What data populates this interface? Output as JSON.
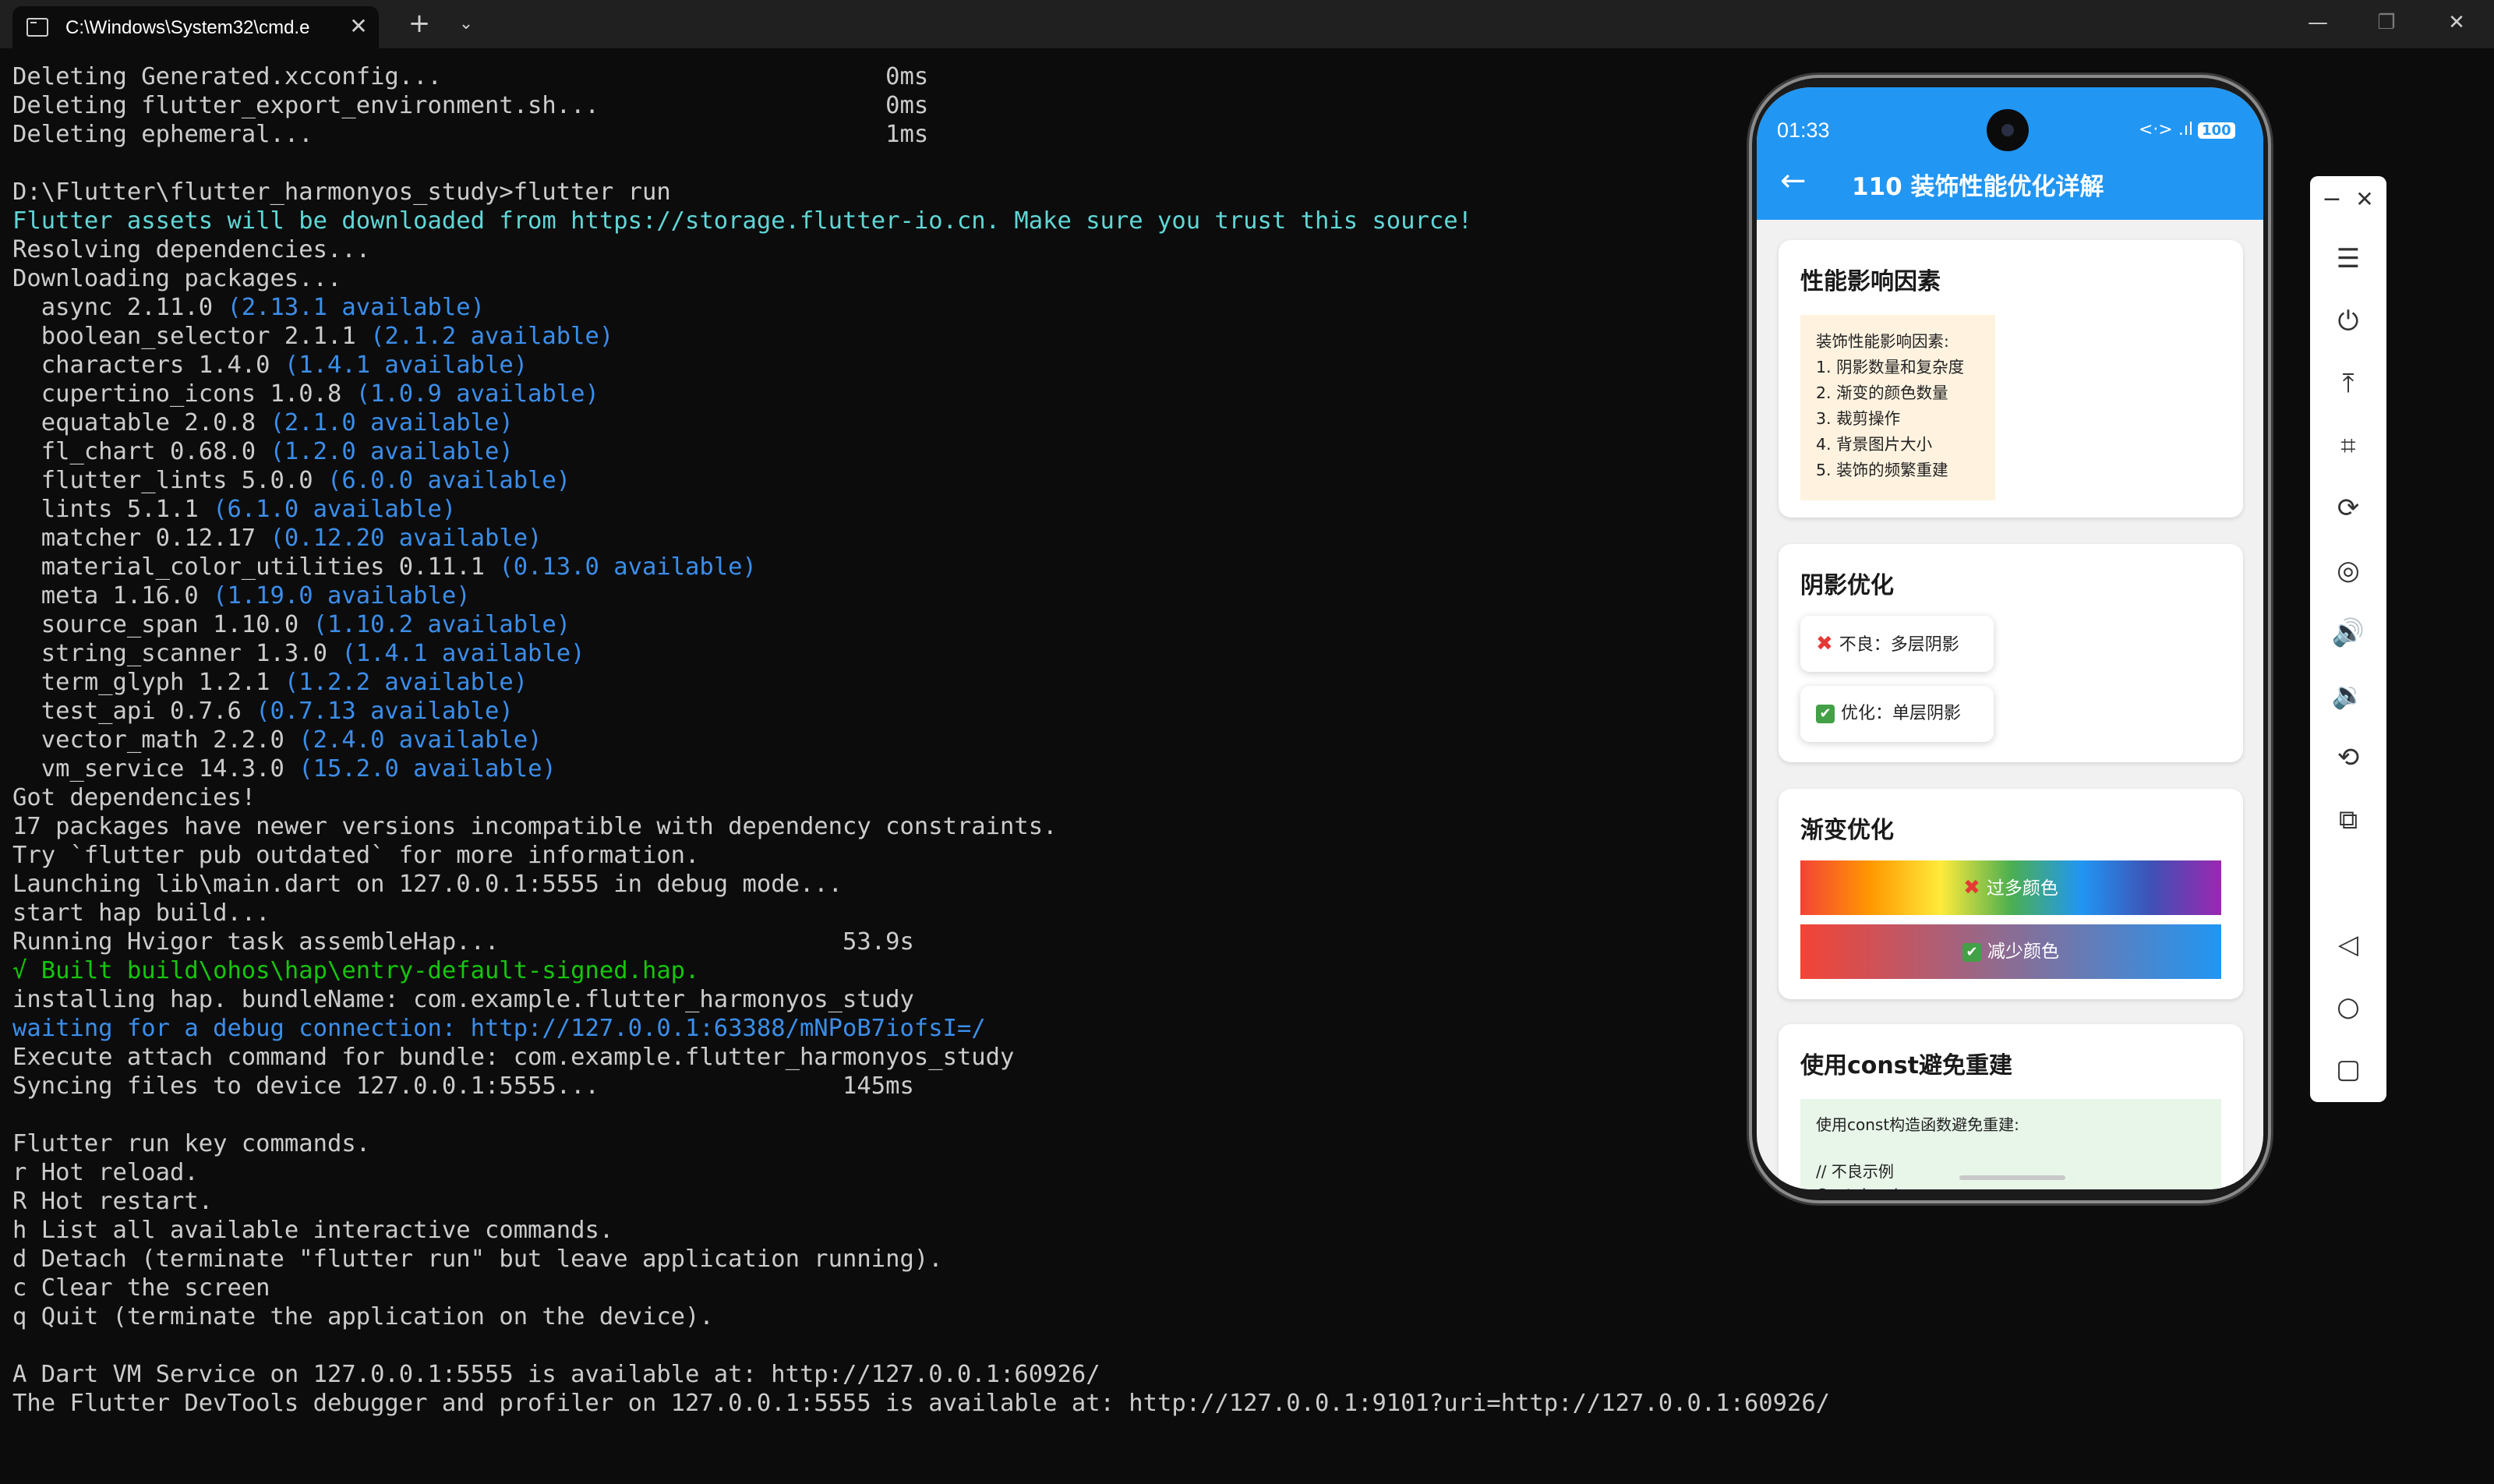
{
  "window": {
    "tab_title": "C:\\Windows\\System32\\cmd.e",
    "tab_close": "✕",
    "new_tab": "+",
    "tab_dropdown": "⌄",
    "minimize": "—",
    "maximize": "❐",
    "close": "✕"
  },
  "terminal": {
    "lines": [
      [
        {
          "t": "Deleting Generated.xcconfig...                               0ms"
        }
      ],
      [
        {
          "t": "Deleting flutter_export_environment.sh...                    0ms"
        }
      ],
      [
        {
          "t": "Deleting ephemeral...                                        1ms"
        }
      ],
      [
        {
          "t": ""
        }
      ],
      [
        {
          "t": "D:\\Flutter\\flutter_harmonyos_study>flutter run"
        }
      ],
      [
        {
          "t": "Flutter assets will be downloaded from https://storage.flutter-io.cn. Make sure you trust this source!",
          "c": "cyan"
        }
      ],
      [
        {
          "t": "Resolving dependencies..."
        }
      ],
      [
        {
          "t": "Downloading packages..."
        }
      ],
      [
        {
          "t": "  async 2.11.0 "
        },
        {
          "t": "(2.13.1 available)",
          "c": "blue"
        }
      ],
      [
        {
          "t": "  boolean_selector 2.1.1 "
        },
        {
          "t": "(2.1.2 available)",
          "c": "blue"
        }
      ],
      [
        {
          "t": "  characters 1.4.0 "
        },
        {
          "t": "(1.4.1 available)",
          "c": "blue"
        }
      ],
      [
        {
          "t": "  cupertino_icons 1.0.8 "
        },
        {
          "t": "(1.0.9 available)",
          "c": "blue"
        }
      ],
      [
        {
          "t": "  equatable 2.0.8 "
        },
        {
          "t": "(2.1.0 available)",
          "c": "blue"
        }
      ],
      [
        {
          "t": "  fl_chart 0.68.0 "
        },
        {
          "t": "(1.2.0 available)",
          "c": "blue"
        }
      ],
      [
        {
          "t": "  flutter_lints 5.0.0 "
        },
        {
          "t": "(6.0.0 available)",
          "c": "blue"
        }
      ],
      [
        {
          "t": "  lints 5.1.1 "
        },
        {
          "t": "(6.1.0 available)",
          "c": "blue"
        }
      ],
      [
        {
          "t": "  matcher 0.12.17 "
        },
        {
          "t": "(0.12.20 available)",
          "c": "blue"
        }
      ],
      [
        {
          "t": "  material_color_utilities 0.11.1 "
        },
        {
          "t": "(0.13.0 available)",
          "c": "blue"
        }
      ],
      [
        {
          "t": "  meta 1.16.0 "
        },
        {
          "t": "(1.19.0 available)",
          "c": "blue"
        }
      ],
      [
        {
          "t": "  source_span 1.10.0 "
        },
        {
          "t": "(1.10.2 available)",
          "c": "blue"
        }
      ],
      [
        {
          "t": "  string_scanner 1.3.0 "
        },
        {
          "t": "(1.4.1 available)",
          "c": "blue"
        }
      ],
      [
        {
          "t": "  term_glyph 1.2.1 "
        },
        {
          "t": "(1.2.2 available)",
          "c": "blue"
        }
      ],
      [
        {
          "t": "  test_api 0.7.6 "
        },
        {
          "t": "(0.7.13 available)",
          "c": "blue"
        }
      ],
      [
        {
          "t": "  vector_math 2.2.0 "
        },
        {
          "t": "(2.4.0 available)",
          "c": "blue"
        }
      ],
      [
        {
          "t": "  vm_service 14.3.0 "
        },
        {
          "t": "(15.2.0 available)",
          "c": "blue"
        }
      ],
      [
        {
          "t": "Got dependencies!"
        }
      ],
      [
        {
          "t": "17 packages have newer versions incompatible with dependency constraints."
        }
      ],
      [
        {
          "t": "Try `flutter pub outdated` for more information."
        }
      ],
      [
        {
          "t": "Launching lib\\main.dart on 127.0.0.1:5555 in debug mode..."
        }
      ],
      [
        {
          "t": "start hap build..."
        }
      ],
      [
        {
          "t": "Running Hvigor task assembleHap...                        53.9s"
        }
      ],
      [
        {
          "t": "√ Built build\\ohos\\hap\\entry-default-signed.hap.",
          "c": "green"
        }
      ],
      [
        {
          "t": "installing hap. bundleName: com.example.flutter_harmonyos_study"
        }
      ],
      [
        {
          "t": "waiting for a debug connection: http://127.0.0.1:63388/mNPoB7iofsI=/",
          "c": "blue"
        }
      ],
      [
        {
          "t": "Execute attach command for bundle: com.example.flutter_harmonyos_study"
        }
      ],
      [
        {
          "t": "Syncing files to device 127.0.0.1:5555...                 145ms"
        }
      ],
      [
        {
          "t": ""
        }
      ],
      [
        {
          "t": "Flutter run key commands."
        }
      ],
      [
        {
          "t": "r Hot reload."
        }
      ],
      [
        {
          "t": "R Hot restart."
        }
      ],
      [
        {
          "t": "h List all available interactive commands."
        }
      ],
      [
        {
          "t": "d Detach (terminate \"flutter run\" but leave application running)."
        }
      ],
      [
        {
          "t": "c Clear the screen"
        }
      ],
      [
        {
          "t": "q Quit (terminate the application on the device)."
        }
      ],
      [
        {
          "t": ""
        }
      ],
      [
        {
          "t": "A Dart VM Service on 127.0.0.1:5555 is available at: http://127.0.0.1:60926/"
        }
      ],
      [
        {
          "t": "The Flutter DevTools debugger and profiler on 127.0.0.1:5555 is available at: http://127.0.0.1:9101?uri=http://127.0.0.1:60926/"
        }
      ]
    ]
  },
  "phone": {
    "status": {
      "time": "01:33",
      "signal_icons": "<·> .ıl",
      "battery": "100"
    },
    "appbar": {
      "back": "←",
      "title": "110 装饰性能优化详解"
    },
    "card_factors": {
      "title": "性能影响因素",
      "lines": [
        "装饰性能影响因素:",
        "1. 阴影数量和复杂度",
        "2. 渐变的颜色数量",
        "3. 裁剪操作",
        "4. 背景图片大小",
        "5. 装饰的频繁重建"
      ]
    },
    "card_shadow": {
      "title": "阴影优化",
      "bad": "不良：多层阴影",
      "good": "优化：单层阴影"
    },
    "card_gradient": {
      "title": "渐变优化",
      "many": "过多颜色",
      "few": "减少颜色"
    },
    "card_const": {
      "title": "使用const避免重建",
      "lines": [
        "使用const构造函数避免重建:",
        "",
        "// 不良示例",
        "Container("
      ]
    },
    "icons": {
      "x": "✖",
      "check": "✔"
    }
  },
  "toolbar": {
    "min": "−",
    "close": "✕",
    "menu": "☰",
    "power": "⏻",
    "upload": "⤒",
    "crop": "⌗",
    "rotate": "⟳",
    "record": "◎",
    "vol_up": "🔊",
    "vol_down": "🔉",
    "shake": "⟲",
    "multi": "⧉",
    "back": "◁",
    "home": "○",
    "recent": "▢"
  },
  "colors": {
    "terminal_bg": "#0c0c0c",
    "accent": "#2196f3",
    "cyan": "#61d6d6",
    "blue": "#3b8eea",
    "green": "#16c60c"
  }
}
